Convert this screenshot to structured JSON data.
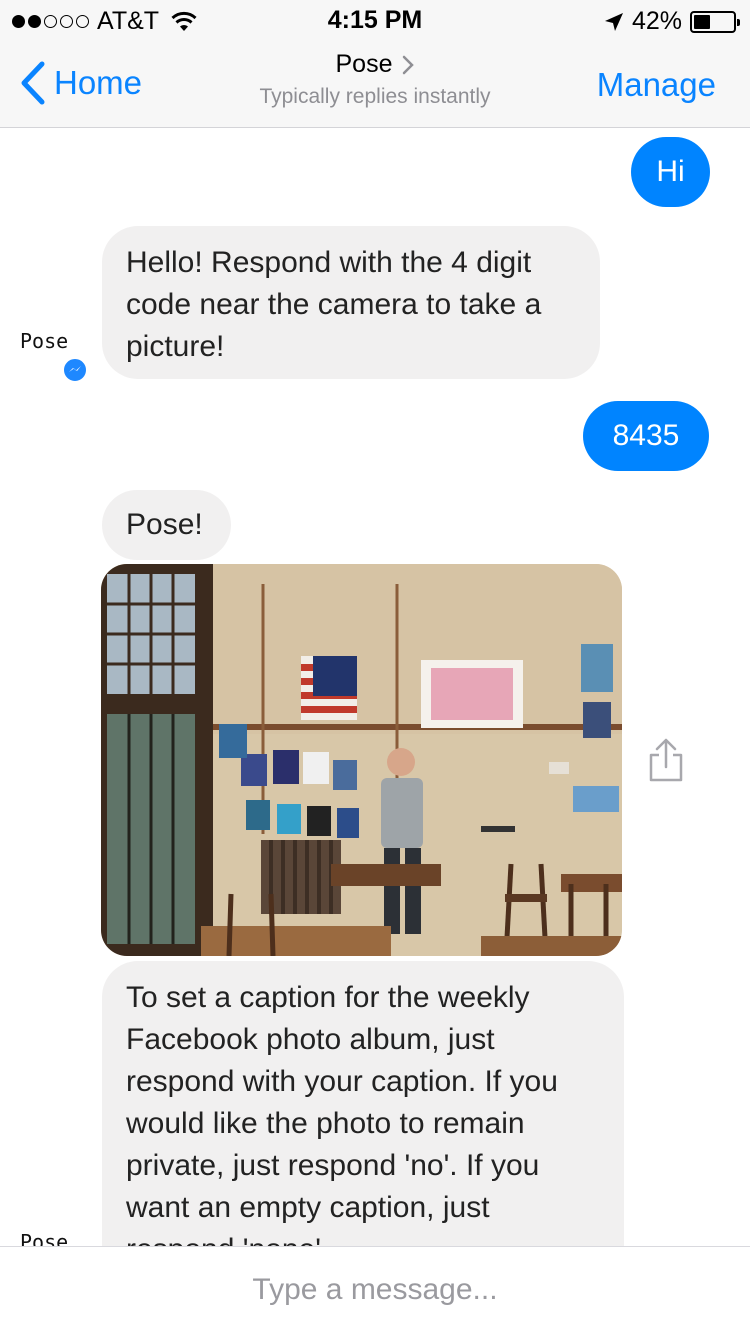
{
  "status_bar": {
    "carrier": "AT&T",
    "time": "4:15 PM",
    "battery": "42%",
    "battery_level": 0.42,
    "signal_bars_filled": 2,
    "signal_bars_total": 5,
    "icons": [
      "wifi-icon",
      "location-arrow-icon",
      "battery-icon"
    ]
  },
  "nav": {
    "back_label": "Home",
    "title": "Pose",
    "subtitle": "Typically replies instantly",
    "manage_label": "Manage"
  },
  "messages": [
    {
      "from": "me",
      "text": "Hi"
    },
    {
      "from": "bot",
      "text": "Hello! Respond with the 4 digit code near the camera to take a picture!"
    },
    {
      "from": "me",
      "text": "8435"
    },
    {
      "from": "bot",
      "text": "Pose!"
    },
    {
      "from": "bot",
      "type": "image"
    },
    {
      "from": "bot",
      "text": "To set a caption for the weekly Facebook photo album, just respond with your caption. If you would like the photo to remain private, just respond 'no'. If you want an empty caption, just respond 'none'."
    }
  ],
  "bot_avatar": {
    "brand_text": "Pose"
  },
  "composer": {
    "placeholder": "Type a message..."
  },
  "colors": {
    "accent": "#0a84ff",
    "outgoing_bubble": "#0084ff",
    "incoming_bubble": "#f1f0f0",
    "bar_background": "#f7f7f7"
  }
}
